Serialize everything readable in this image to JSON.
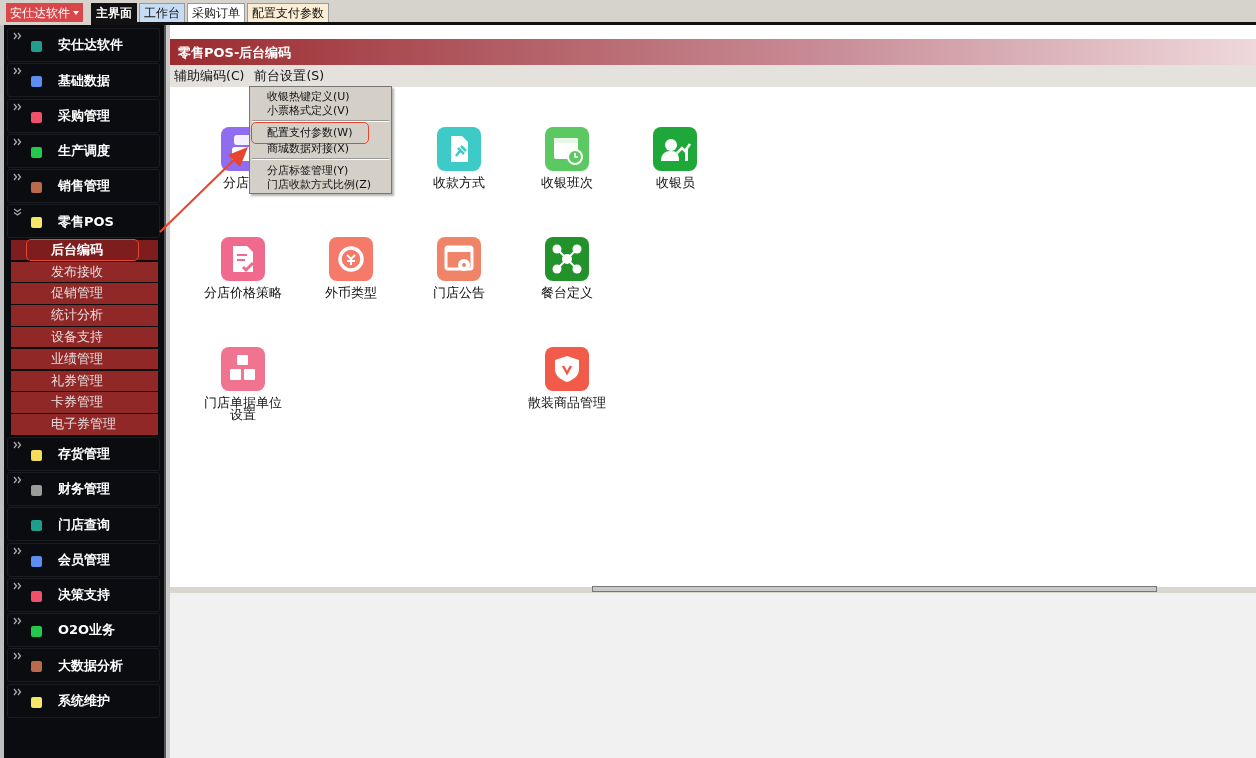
{
  "top_bar": {
    "brand": "安仕达软件",
    "tabs": [
      {
        "label": "主界面",
        "selected": true,
        "color": "#111111"
      },
      {
        "label": "工作台",
        "selected": false,
        "color": "#c6dcf4"
      },
      {
        "label": "采购订单",
        "selected": false,
        "color": "#ffffff"
      },
      {
        "label": "配置支付参数",
        "selected": false,
        "color": "#fbeed5"
      }
    ]
  },
  "sidebar": {
    "items": [
      {
        "label": "安仕达软件",
        "kind": "group",
        "expanded": false,
        "color": "#1f9e8e"
      },
      {
        "label": "基础数据",
        "kind": "group",
        "expanded": false,
        "color": "#5b8ef0"
      },
      {
        "label": "采购管理",
        "kind": "group",
        "expanded": false,
        "color": "#f0506a"
      },
      {
        "label": "生产调度",
        "kind": "group",
        "expanded": false,
        "color": "#22c94a"
      },
      {
        "label": "销售管理",
        "kind": "group",
        "expanded": false,
        "color": "#b86a4a"
      },
      {
        "label": "零售POS",
        "kind": "group",
        "expanded": true,
        "color": "#f5e66a",
        "children": [
          {
            "label": "后台编码",
            "selected": true,
            "highlighted": true
          },
          {
            "label": "发布接收",
            "selected": false,
            "highlighted": false
          },
          {
            "label": "促销管理",
            "selected": false,
            "highlighted": false
          },
          {
            "label": "统计分析",
            "selected": false,
            "highlighted": false
          },
          {
            "label": "设备支持",
            "selected": false,
            "highlighted": false
          },
          {
            "label": "业绩管理",
            "selected": false,
            "highlighted": false
          },
          {
            "label": "礼券管理",
            "selected": false,
            "highlighted": false
          },
          {
            "label": "卡券管理",
            "selected": false,
            "highlighted": false
          },
          {
            "label": "电子券管理",
            "selected": false,
            "highlighted": false
          }
        ]
      },
      {
        "label": "存货管理",
        "kind": "group",
        "expanded": false,
        "color": "#f5dd5a"
      },
      {
        "label": "财务管理",
        "kind": "group",
        "expanded": false,
        "color": "#9a9a9a"
      },
      {
        "label": "门店查询",
        "kind": "leaf",
        "color": "#1f9e8e"
      },
      {
        "label": "会员管理",
        "kind": "group",
        "expanded": false,
        "color": "#5b8ef0"
      },
      {
        "label": "决策支持",
        "kind": "group",
        "expanded": false,
        "color": "#f0506a"
      },
      {
        "label": "O2O业务",
        "kind": "group",
        "expanded": false,
        "color": "#22c94a"
      },
      {
        "label": "大数据分析",
        "kind": "group",
        "expanded": false,
        "color": "#b86a4a"
      },
      {
        "label": "系统维护",
        "kind": "group",
        "expanded": false,
        "color": "#f5e66a"
      }
    ]
  },
  "panel": {
    "title": "零售POS-后台编码",
    "menu_bar": [
      "辅助编码(C)",
      "前台设置(S)"
    ],
    "dropdown": [
      {
        "kind": "item",
        "label": "收银热键定义(U)",
        "highlighted": false
      },
      {
        "kind": "item",
        "label": "小票格式定义(V)",
        "highlighted": false
      },
      {
        "kind": "separator"
      },
      {
        "kind": "item",
        "label": "配置支付参数(W)",
        "highlighted": true
      },
      {
        "kind": "item",
        "label": "商城数据对接(X)",
        "highlighted": false
      },
      {
        "kind": "separator"
      },
      {
        "kind": "item",
        "label": "分店标签管理(Y)",
        "highlighted": false
      },
      {
        "kind": "item",
        "label": "门店收款方式比例(Z)",
        "highlighted": false
      }
    ],
    "tile_rows": [
      [
        {
          "label": "分店",
          "color": "#8f6cf0",
          "cut": true
        },
        null,
        {
          "label": "收款方式",
          "color": "#3ecbc8"
        },
        {
          "label": "收银班次",
          "color": "#5cc862"
        },
        {
          "label": "收银员",
          "color": "#1fa83a"
        }
      ],
      [
        {
          "label": "分店价格策略",
          "color": "#f06a8e"
        },
        {
          "label": "外币类型",
          "color": "#f57a6a"
        },
        {
          "label": "门店公告",
          "color": "#ef8468"
        },
        {
          "label": "餐台定义",
          "color": "#22922a"
        }
      ],
      [
        {
          "label": "门店单据单位设置",
          "color": "#f0738f"
        },
        null,
        null,
        {
          "label": "散装商品管理",
          "color": "#f25a4a"
        }
      ]
    ]
  }
}
